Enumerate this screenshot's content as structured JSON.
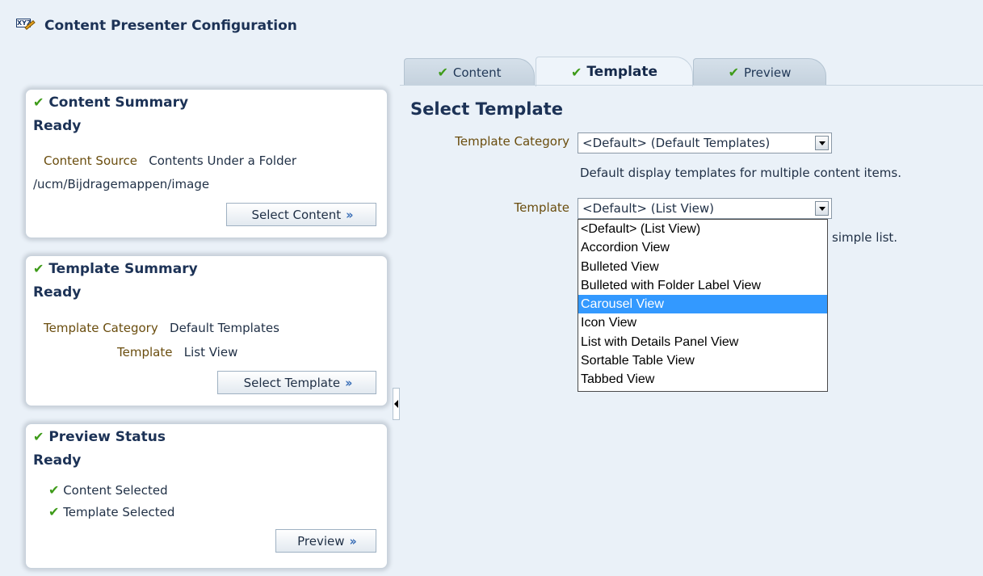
{
  "app": {
    "title": "Content Presenter Configuration",
    "icon": "xyz-edit-icon"
  },
  "tabs": [
    {
      "label": "Content",
      "icon": "check-icon",
      "active": false
    },
    {
      "label": "Template",
      "icon": "check-icon",
      "active": true
    },
    {
      "label": "Preview",
      "icon": "check-icon",
      "active": false
    }
  ],
  "content_summary": {
    "title": "Content Summary",
    "status": "Ready",
    "source_label": "Content Source",
    "source_value": "Contents Under a Folder",
    "path": "/ucm/Bijdragemappen/image",
    "button": "Select Content"
  },
  "template_summary": {
    "title": "Template Summary",
    "status": "Ready",
    "category_label": "Template Category",
    "category_value": "Default Templates",
    "template_label": "Template",
    "template_value": "List View",
    "button": "Select Template"
  },
  "preview_status": {
    "title": "Preview Status",
    "status": "Ready",
    "items": [
      "Content Selected",
      "Template Selected"
    ],
    "button": "Preview"
  },
  "main": {
    "title": "Select Template",
    "category_label": "Template Category",
    "category_value": "<Default> (Default Templates)",
    "category_desc": "Default display templates for multiple content items.",
    "template_label": "Template",
    "template_value": "<Default> (List View)",
    "template_desc_partial": "simple list.",
    "template_options": [
      "<Default> (List View)",
      "Accordion View",
      "Bulleted View",
      "Bulleted with Folder Label View",
      "Carousel View",
      "Icon View",
      "List with Details Panel View",
      "Sortable Table View",
      "Tabbed View"
    ],
    "highlighted_option": "Carousel View"
  },
  "colors": {
    "accent_check": "#3e9b19",
    "highlight": "#3399ff",
    "background": "#eaf1f8"
  }
}
